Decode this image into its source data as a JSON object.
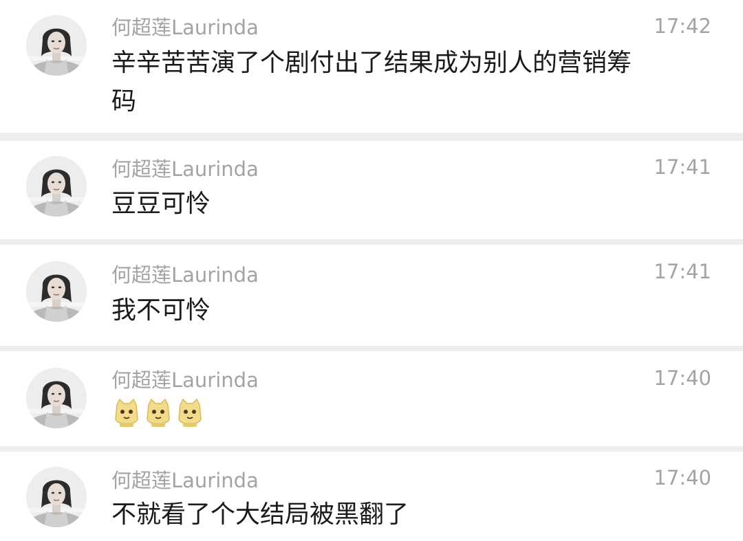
{
  "messages": [
    {
      "sender": "何超莲Laurinda",
      "time": "17:42",
      "text": "辛辛苦苦演了个剧付出了结果成为别人的营销筹码",
      "avatar_icon": "profile-photo-avatar"
    },
    {
      "sender": "何超莲Laurinda",
      "time": "17:41",
      "text": "豆豆可怜",
      "avatar_icon": "profile-photo-avatar"
    },
    {
      "sender": "何超莲Laurinda",
      "time": "17:41",
      "text": "我不可怜",
      "avatar_icon": "profile-photo-avatar"
    },
    {
      "sender": "何超莲Laurinda",
      "time": "17:40",
      "text": "",
      "emojis": [
        "yellow-face-emoji",
        "yellow-face-emoji",
        "yellow-face-emoji"
      ],
      "avatar_icon": "profile-photo-avatar"
    },
    {
      "sender": "何超莲Laurinda",
      "time": "17:40",
      "text": "不就看了个大结局被黑翻了",
      "avatar_icon": "profile-photo-avatar"
    }
  ],
  "colors": {
    "background": "#ffffff",
    "divider": "#eeeeef",
    "meta_text": "#a3a3a3",
    "message_text": "#1a1a1a",
    "emoji_fill": "#f2dc8c"
  }
}
